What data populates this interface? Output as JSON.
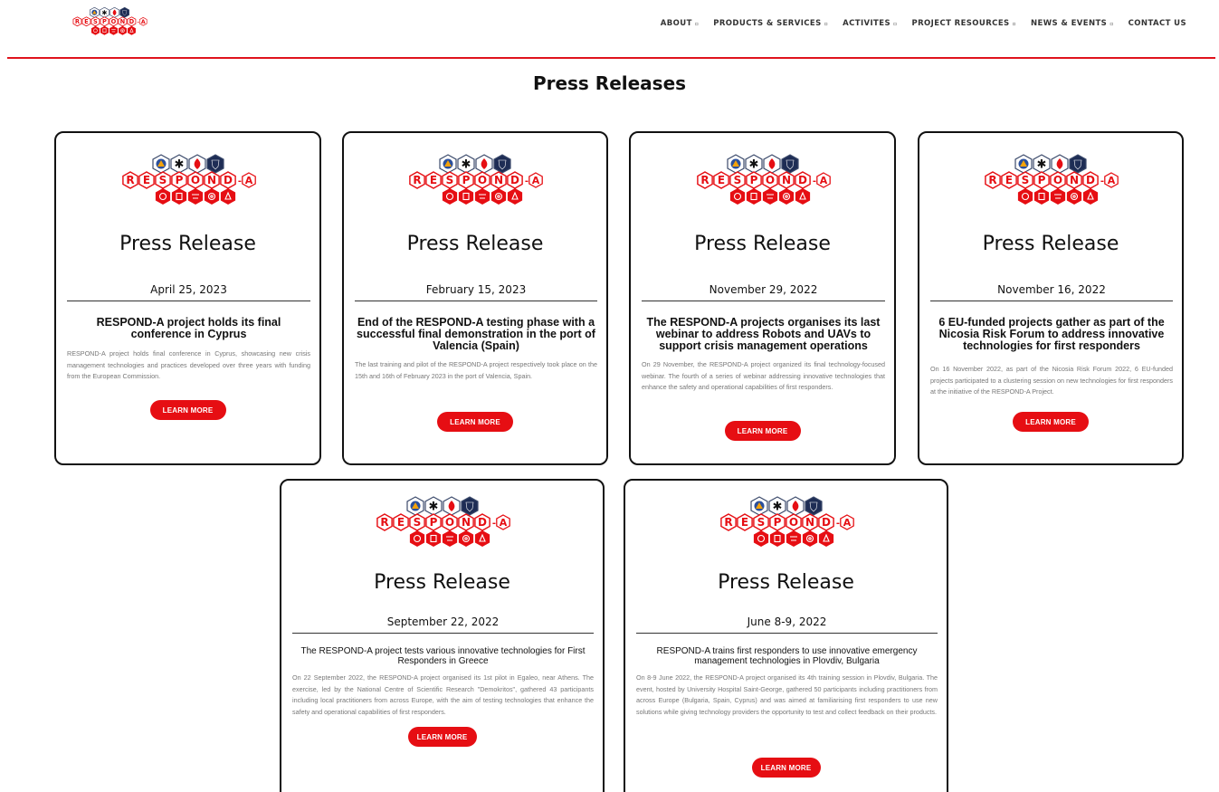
{
  "brand": {
    "logo_alt": "RESPOND-A",
    "accent_color": "#e60e13",
    "line_color": "#e0141d"
  },
  "nav": {
    "items": [
      {
        "label": "ABOUT",
        "has_dropdown": true
      },
      {
        "label": "PRODUCTS & SERVICES",
        "has_dropdown": true
      },
      {
        "label": "ACTIVITES",
        "has_dropdown": true
      },
      {
        "label": "PROJECT RESOURCES",
        "has_dropdown": true
      },
      {
        "label": "NEWS & EVENTS",
        "has_dropdown": true
      },
      {
        "label": "CONTACT US",
        "has_dropdown": false
      }
    ],
    "dropdown_glyph": "▫"
  },
  "page": {
    "title": "Press Releases"
  },
  "cards": [
    {
      "heading": "Press Release",
      "date": "April 25, 2023",
      "title": "RESPOND-A project holds its final conference in Cyprus",
      "description": "RESPOND-A project holds final conference in Cyprus, showcasing new crisis management technologies and practices developed over three years with funding from the European Commission.",
      "button": "LEARN MORE"
    },
    {
      "heading": "Press Release",
      "date": "February 15, 2023",
      "title": "End of the RESPOND-A testing phase with a successful final demonstration in the port of Valencia (Spain)",
      "description": "The last training and pilot of the RESPOND-A project respectively took place on the 15th and 16th of February 2023 in the port of Valencia, Spain.",
      "button": "LEARN MORE"
    },
    {
      "heading": "Press Release",
      "date": "November 29, 2022",
      "title": "The RESPOND-A projects organises its last webinar to address Robots and UAVs to support crisis management operations",
      "description": "On 29 November, the RESPOND-A project organized its final technology-focused webinar. The fourth of a series of webinar addressing innovative technologies that enhance the safety and operational capabilities of first responders.",
      "button": "LEARN MORE"
    },
    {
      "heading": "Press Release",
      "date": "November 16, 2022",
      "title": "6 EU-funded projects gather as part of the Nicosia Risk Forum to address innovative technologies for first responders",
      "description": "On 16 November 2022, as part of the Nicosia Risk Forum 2022, 6 EU-funded projects participated to a clustering session on new technologies for first responders at the initiative of the RESPOND-A Project.",
      "button": "LEARN MORE"
    },
    {
      "heading": "Press Release",
      "date": "September 22, 2022",
      "title": "The RESPOND-A project tests various innovative technologies for First Responders in Greece",
      "description": "On 22 September 2022, the RESPOND-A project organised its 1st pilot in Egaleo, near Athens. The exercise, led by the National Centre of Scientific Research \"Demokritos\", gathered 43 participants including local practitioners from across Europe, with the aim of testing technologies that enhance the safety and operational capabilities of first responders.",
      "button": "LEARN MORE"
    },
    {
      "heading": "Press Release",
      "date": "June 8-9, 2022",
      "title": "RESPOND-A trains first responders to use innovative emergency management technologies in Plovdiv, Bulgaria",
      "description": "On 8-9 June 2022, the RESPOND-A project organised its 4th training session in Plovdiv, Bulgaria. The event, hosted by University Hospital Saint-George, gathered 50 participants including practitioners from across Europe (Bulgaria, Spain, Cyprus) and was aimed at familiarising first responders to use new solutions while giving technology providers the opportunity to test and collect feedback on their products.",
      "button": "LEARN MORE"
    }
  ]
}
